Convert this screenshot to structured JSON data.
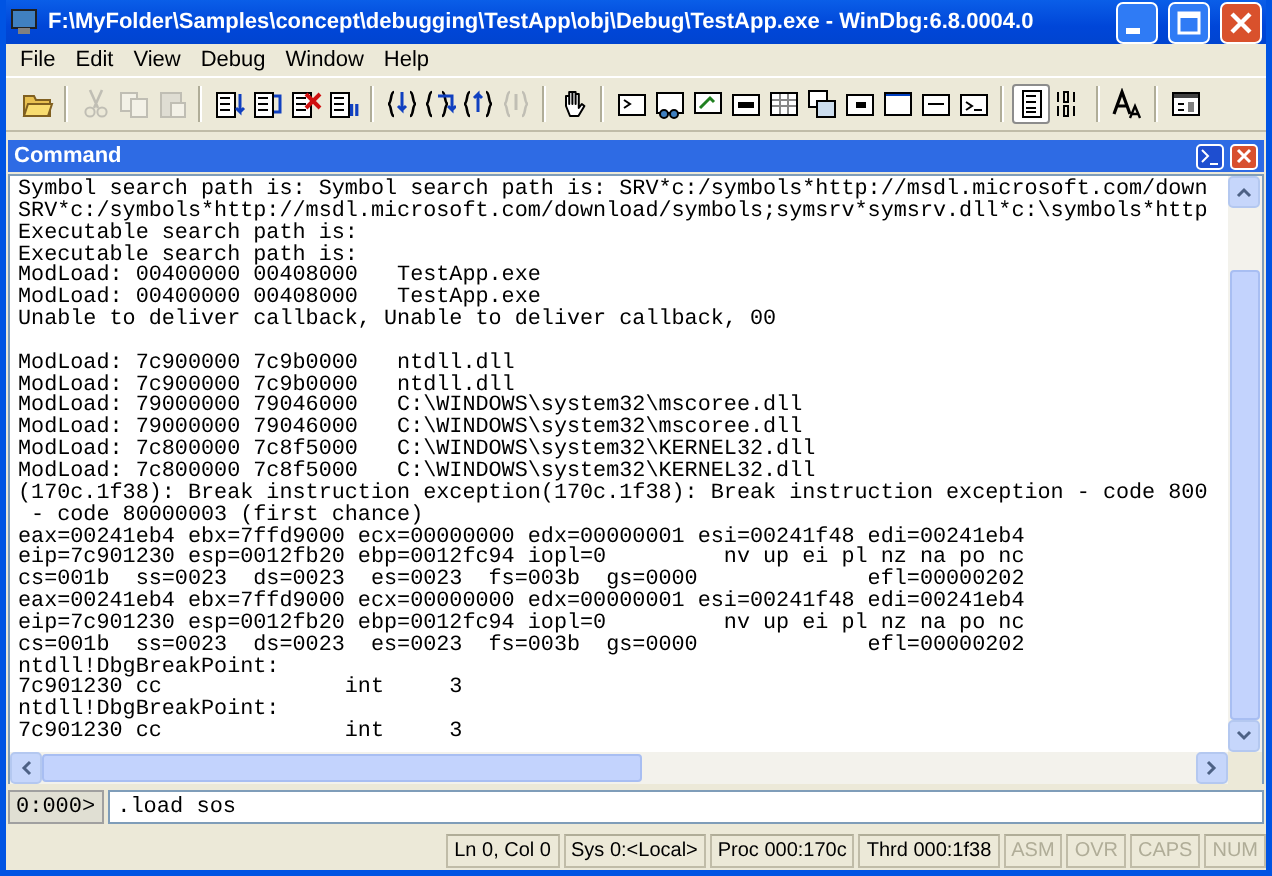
{
  "window": {
    "title": "F:\\MyFolder\\Samples\\concept\\debugging\\TestApp\\obj\\Debug\\TestApp.exe - WinDbg:6.8.0004.0"
  },
  "menu": [
    "File",
    "Edit",
    "View",
    "Debug",
    "Window",
    "Help"
  ],
  "toolbar": [
    {
      "kind": "open",
      "disabled": false,
      "pressed": false
    },
    {
      "kind": "separator"
    },
    {
      "kind": "cut",
      "disabled": true,
      "pressed": false
    },
    {
      "kind": "copy",
      "disabled": true,
      "pressed": false
    },
    {
      "kind": "paste",
      "disabled": true,
      "pressed": false
    },
    {
      "kind": "separator"
    },
    {
      "kind": "go",
      "disabled": false,
      "pressed": false
    },
    {
      "kind": "restart",
      "disabled": false,
      "pressed": false
    },
    {
      "kind": "stop",
      "disabled": false,
      "pressed": false
    },
    {
      "kind": "break",
      "disabled": false,
      "pressed": false
    },
    {
      "kind": "separator"
    },
    {
      "kind": "step-into",
      "disabled": false,
      "pressed": false
    },
    {
      "kind": "step-over",
      "disabled": false,
      "pressed": false
    },
    {
      "kind": "step-out",
      "disabled": false,
      "pressed": false
    },
    {
      "kind": "run-to-cursor",
      "disabled": true,
      "pressed": false
    },
    {
      "kind": "separator"
    },
    {
      "kind": "hand",
      "disabled": false,
      "pressed": false
    },
    {
      "kind": "separator"
    },
    {
      "kind": "command",
      "disabled": false,
      "pressed": false
    },
    {
      "kind": "watch",
      "disabled": false,
      "pressed": false
    },
    {
      "kind": "locals",
      "disabled": false,
      "pressed": false
    },
    {
      "kind": "registers",
      "disabled": false,
      "pressed": false
    },
    {
      "kind": "memory",
      "disabled": false,
      "pressed": false
    },
    {
      "kind": "call-stack",
      "disabled": false,
      "pressed": false
    },
    {
      "kind": "disassembly",
      "disabled": false,
      "pressed": false
    },
    {
      "kind": "scratch",
      "disabled": false,
      "pressed": false
    },
    {
      "kind": "processes",
      "disabled": false,
      "pressed": false
    },
    {
      "kind": "console",
      "disabled": false,
      "pressed": false
    },
    {
      "kind": "separator"
    },
    {
      "kind": "source-mode",
      "disabled": false,
      "pressed": true
    },
    {
      "kind": "hex",
      "disabled": false,
      "pressed": false
    },
    {
      "kind": "separator"
    },
    {
      "kind": "font",
      "disabled": false,
      "pressed": false
    },
    {
      "kind": "separator"
    },
    {
      "kind": "options",
      "disabled": false,
      "pressed": false
    }
  ],
  "command_pane": {
    "title": "Command",
    "output_blocks": [
      [
        "Symbol search path is: Symbol search path is: SRV*c:/symbols*http://msdl.microsoft.com/down",
        "SRV*c:/symbols*http://msdl.microsoft.com/download/symbols;symsrv*symsrv.dll*c:\\symbols*http",
        "Executable search path is:",
        "Executable search path is:",
        "ModLoad: 00400000 00408000   TestApp.exe",
        "ModLoad: 00400000 00408000   TestApp.exe",
        "Unable to deliver callback, Unable to deliver callback, 00"
      ],
      [
        "ModLoad: 7c900000 7c9b0000   ntdll.dll",
        "ModLoad: 7c900000 7c9b0000   ntdll.dll",
        "ModLoad: 79000000 79046000   C:\\WINDOWS\\system32\\mscoree.dll",
        "ModLoad: 79000000 79046000   C:\\WINDOWS\\system32\\mscoree.dll",
        "ModLoad: 7c800000 7c8f5000   C:\\WINDOWS\\system32\\KERNEL32.dll",
        "ModLoad: 7c800000 7c8f5000   C:\\WINDOWS\\system32\\KERNEL32.dll",
        "(170c.1f38): Break instruction exception(170c.1f38): Break instruction exception - code 800",
        " - code 80000003 (first chance)",
        "eax=00241eb4 ebx=7ffd9000 ecx=00000000 edx=00000001 esi=00241f48 edi=00241eb4",
        "eip=7c901230 esp=0012fb20 ebp=0012fc94 iopl=0         nv up ei pl nz na po nc",
        "cs=001b  ss=0023  ds=0023  es=0023  fs=003b  gs=0000             efl=00000202",
        "eax=00241eb4 ebx=7ffd9000 ecx=00000000 edx=00000001 esi=00241f48 edi=00241eb4",
        "eip=7c901230 esp=0012fb20 ebp=0012fc94 iopl=0         nv up ei pl nz na po nc",
        "cs=001b  ss=0023  ds=0023  es=0023  fs=003b  gs=0000             efl=00000202",
        "ntdll!DbgBreakPoint:",
        "7c901230 cc              int     3",
        "ntdll!DbgBreakPoint:",
        "7c901230 cc              int     3"
      ]
    ],
    "prompt": "0:000>",
    "input": {
      "value": ".load sos"
    }
  },
  "status_bar": [
    {
      "text": "Ln 0, Col 0",
      "disabled": false
    },
    {
      "text": "Sys 0:<Local>",
      "disabled": false
    },
    {
      "text": "Proc 000:170c",
      "disabled": false
    },
    {
      "text": "Thrd 000:1f38",
      "disabled": false
    },
    {
      "text": "ASM",
      "disabled": true
    },
    {
      "text": "OVR",
      "disabled": true
    },
    {
      "text": "CAPS",
      "disabled": true
    },
    {
      "text": "NUM",
      "disabled": true
    }
  ]
}
